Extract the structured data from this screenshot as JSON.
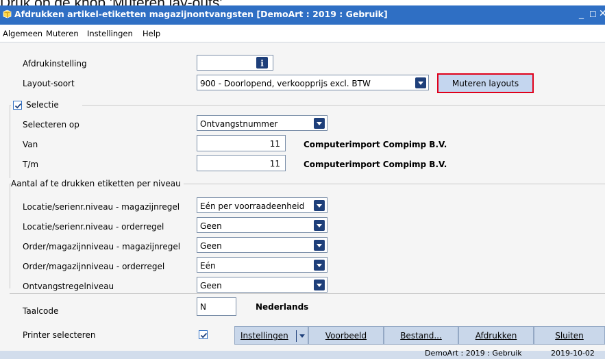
{
  "instruction": "Druk op de knop 'Muteren lay-outs'",
  "window": {
    "title": "Afdrukken artikel-etiketten magazijnontvangsten [DemoArt : 2019 : Gebruik]",
    "minimize": "_",
    "maximize": "☐",
    "close": "✕"
  },
  "menu": [
    "Algemeen",
    "Muteren",
    "Instellingen",
    "Help"
  ],
  "form": {
    "afdrukinstelling_label": "Afdrukinstelling",
    "afdrukinstelling_value": "",
    "layout_label": "Layout-soort",
    "layout_value": "900 - Doorlopend, verkoopprijs excl. BTW",
    "muteren_layouts": "Muteren layouts"
  },
  "selectie": {
    "group_label": "Selectie",
    "selecteren_op_label": "Selecteren op",
    "selecteren_op_value": "Ontvangstnummer",
    "van_label": "Van",
    "van_value": "11",
    "van_name": "Computerimport Compimp B.V.",
    "tm_label": "T/m",
    "tm_value": "11",
    "tm_name": "Computerimport Compimp B.V."
  },
  "aantal": {
    "group_label": "Aantal af te drukken etiketten per niveau",
    "rows": [
      {
        "label": "Locatie/serienr.niveau - magazijnregel",
        "value": "Eén per voorraadeenheid"
      },
      {
        "label": "Locatie/serienr.niveau - orderregel",
        "value": "Geen"
      },
      {
        "label": "Order/magazijnniveau - magazijnregel",
        "value": "Geen"
      },
      {
        "label": "Order/magazijnniveau - orderregel",
        "value": "Eén"
      },
      {
        "label": "Ontvangstregelniveau",
        "value": "Geen"
      }
    ]
  },
  "taal": {
    "label": "Taalcode",
    "code": "N",
    "name": "Nederlands"
  },
  "printer": {
    "label": "Printer selecteren",
    "checked": true
  },
  "buttons": {
    "instellingen": "Instellingen",
    "voorbeeld": "Voorbeeld",
    "bestand": "Bestand...",
    "afdrukken": "Afdrukken",
    "sluiten": "Sluiten"
  },
  "status": {
    "text": "DemoArt : 2019 : Gebruik",
    "date": "2019-10-02"
  },
  "colors": {
    "titlebar": "#2f6fc4",
    "highlight": "#e0001a",
    "button": "#c9d7ea",
    "dropdown": "#1e3f7a"
  }
}
